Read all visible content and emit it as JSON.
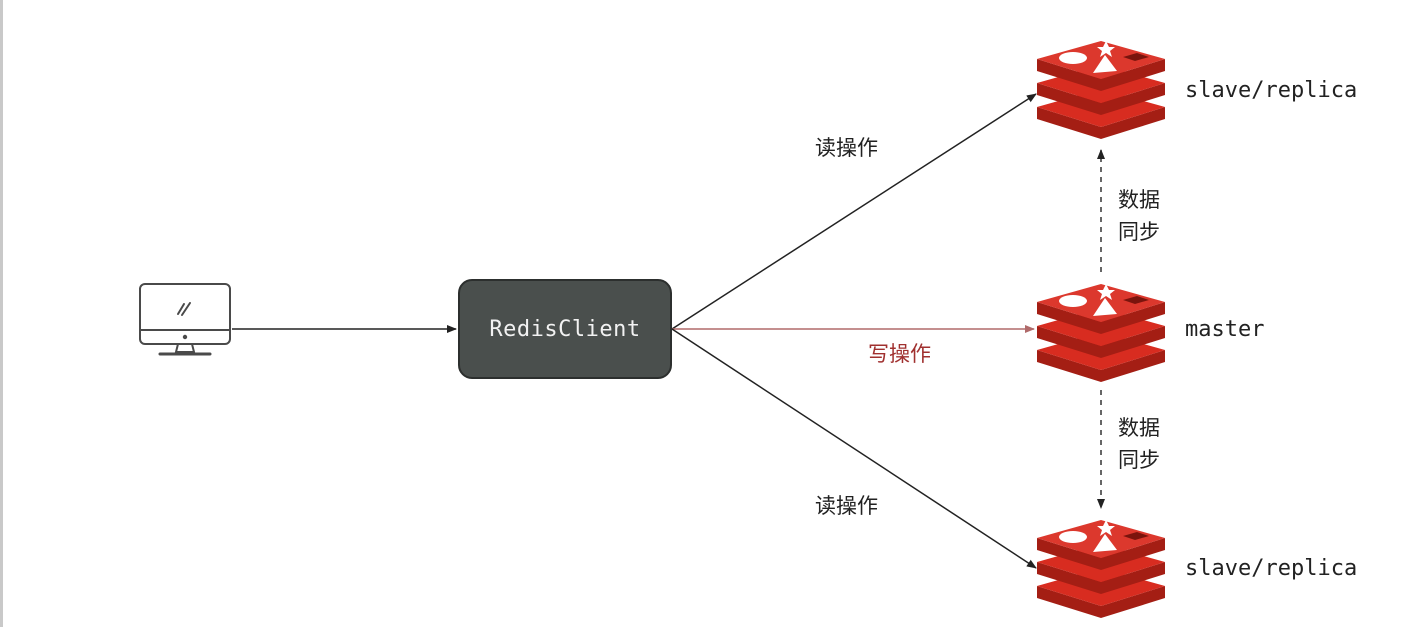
{
  "client": {
    "label": "RedisClient"
  },
  "nodes": [
    {
      "role": "slave-top",
      "label": "slave/replica"
    },
    {
      "role": "master",
      "label": "master"
    },
    {
      "role": "slave-bottom",
      "label": "slave/replica"
    }
  ],
  "edges": {
    "read_top": "读操作",
    "write": "写操作",
    "read_bottom": "读操作"
  },
  "sync": {
    "upper": {
      "line1": "数据",
      "line2": "同步"
    },
    "lower": {
      "line1": "数据",
      "line2": "同步"
    }
  },
  "colors": {
    "redis_red": "#d82c20",
    "redis_dark": "#a41e14",
    "client_box": "#4a4f4d",
    "write_arrow": "#b06a6a",
    "write_text": "#a0302f"
  },
  "icons": {
    "computer": "desktop-monitor-icon",
    "redis": "redis-logo-icon"
  }
}
